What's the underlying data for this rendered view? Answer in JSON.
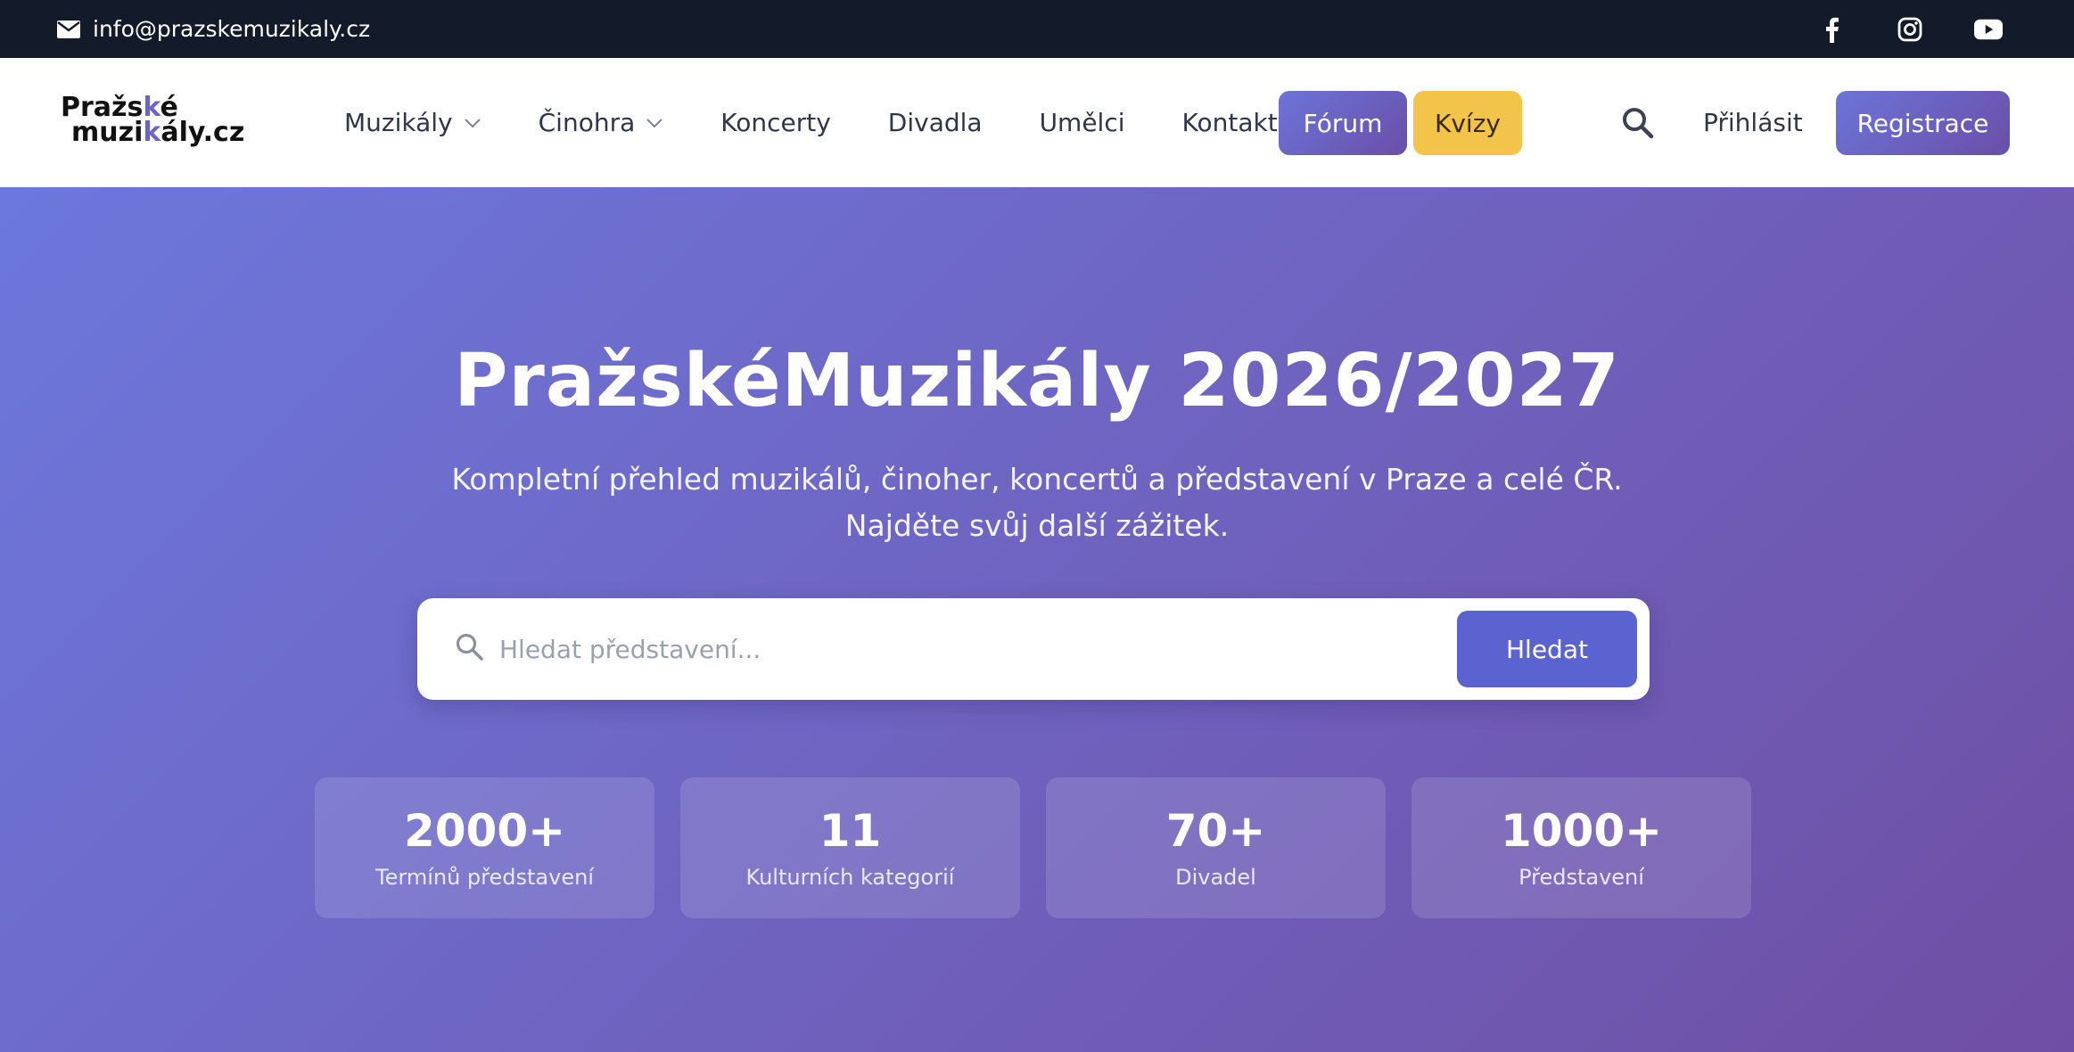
{
  "topbar": {
    "email": "info@prazskemuzikaly.cz",
    "socials": [
      {
        "name": "facebook-icon"
      },
      {
        "name": "instagram-icon"
      },
      {
        "name": "youtube-icon"
      }
    ]
  },
  "nav": {
    "logo": {
      "line1_a": "Pražs",
      "line1_b": "k",
      "line1_c": "é",
      "line2_a": "muzi",
      "line2_b": "k",
      "line2_c": "ály.cz"
    },
    "items": [
      {
        "label": "Muzikály",
        "dropdown": true
      },
      {
        "label": "Činohra",
        "dropdown": true
      },
      {
        "label": "Koncerty"
      },
      {
        "label": "Divadla"
      },
      {
        "label": "Umělci"
      },
      {
        "label": "Kontakty"
      }
    ],
    "forum": "Fórum",
    "kvizy": "Kvízy",
    "login": "Přihlásit",
    "register": "Registrace"
  },
  "hero": {
    "title": "PražskéMuzikály 2026/2027",
    "subtitle_line1": "Kompletní přehled muzikálů, činoher, koncertů a představení v Praze a celé ČR.",
    "subtitle_line2": "Najděte svůj další zážitek.",
    "search": {
      "placeholder": "Hledat představení...",
      "button": "Hledat"
    },
    "stats": [
      {
        "value": "2000+",
        "label": "Termínů představení"
      },
      {
        "value": "11",
        "label": "Kulturních kategorií"
      },
      {
        "value": "70+",
        "label": "Divadel"
      },
      {
        "value": "1000+",
        "label": "Představení"
      }
    ]
  },
  "colors": {
    "topbar": "#131a29",
    "accent": "#6c74d8",
    "quiz": "#f3c44a",
    "button": "#5a63cf"
  }
}
